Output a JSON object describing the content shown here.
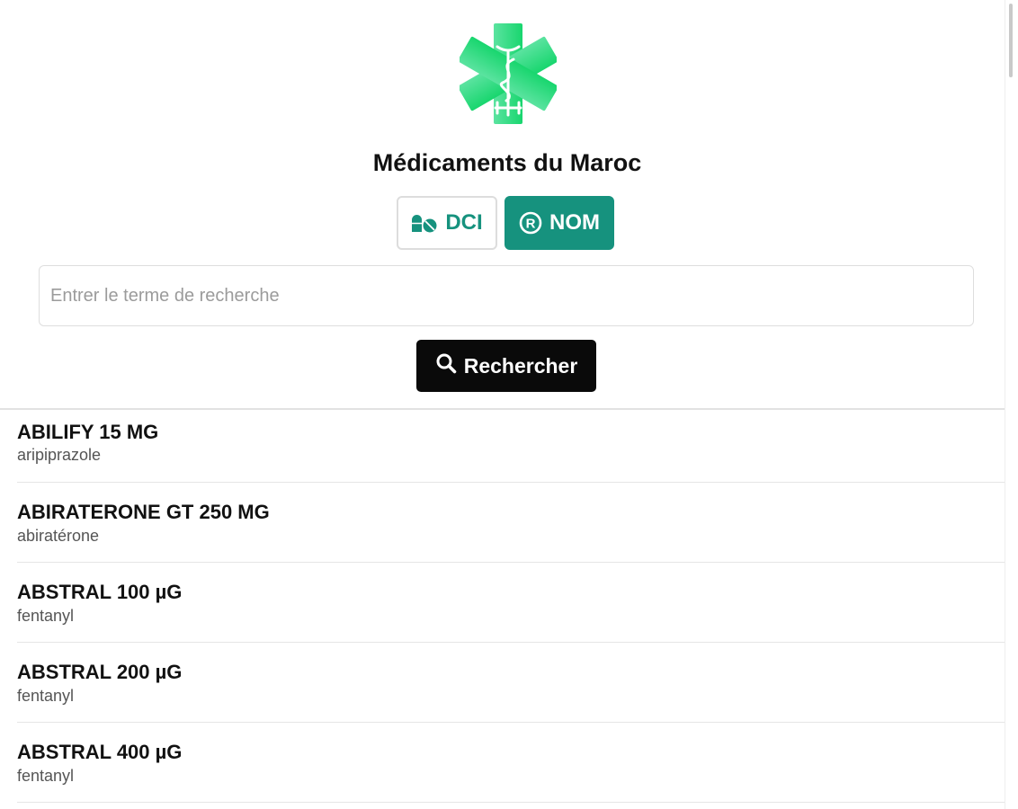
{
  "app": {
    "title": "Médicaments du Maroc"
  },
  "mode_toggle": {
    "dci_label": "DCI",
    "nom_label": "NOM",
    "active": "NOM"
  },
  "search": {
    "placeholder": "Entrer le terme de recherche",
    "value": "",
    "button_label": "Rechercher"
  },
  "results": [
    {
      "name": "ABILIFY 15 MG",
      "dci": "aripiprazole"
    },
    {
      "name": "ABIRATERONE GT 250 MG",
      "dci": "abiratérone"
    },
    {
      "name": "ABSTRAL 100 µG",
      "dci": "fentanyl"
    },
    {
      "name": "ABSTRAL 200 µG",
      "dci": "fentanyl"
    },
    {
      "name": "ABSTRAL 400 µG",
      "dci": "fentanyl"
    }
  ],
  "colors": {
    "accent": "#16927e",
    "logo_green_light": "#5be3a0",
    "logo_green": "#18d66e",
    "search_button": "#0a0a0a"
  },
  "icons": {
    "logo": "star-of-life-icon",
    "dci": "pills-icon",
    "nom": "registered-icon",
    "search": "search-icon"
  }
}
